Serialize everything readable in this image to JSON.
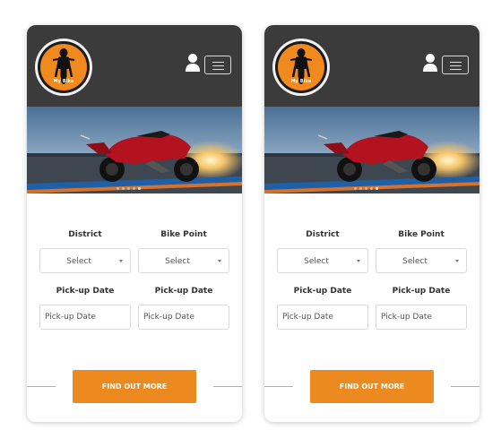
{
  "screens": [
    {
      "brand": {
        "logo_text": "My Bike"
      },
      "carousel": {
        "slides": 5,
        "active_index": 4
      },
      "form": {
        "district_label": "District",
        "district_value": "Select",
        "bike_point_label": "Bike Point",
        "bike_point_value": "Select",
        "pickup_label_1": "Pick-up Date",
        "pickup_placeholder_1": "Pick-up Date",
        "pickup_label_2": "Pick-up Date",
        "pickup_placeholder_2": "Pick-up Date"
      },
      "cta_label": "FIND OUT MORE"
    },
    {
      "brand": {
        "logo_text": "My Bike"
      },
      "carousel": {
        "slides": 5,
        "active_index": 4
      },
      "form": {
        "district_label": "District",
        "district_value": "Select",
        "bike_point_label": "Bike Point",
        "bike_point_value": "Select",
        "pickup_label_1": "Pick-up Date",
        "pickup_placeholder_1": "Pick-up Date",
        "pickup_label_2": "Pick-up Date",
        "pickup_placeholder_2": "Pick-up Date"
      },
      "cta_label": "FIND OUT MORE"
    }
  ],
  "colors": {
    "header_bg": "#3b3b3b",
    "accent": "#ec8a1f",
    "logo_bg": "#f0891e"
  },
  "icons": [
    "motorbike-logo-icon",
    "user-icon",
    "hamburger-menu-icon",
    "select-caret-icon"
  ]
}
